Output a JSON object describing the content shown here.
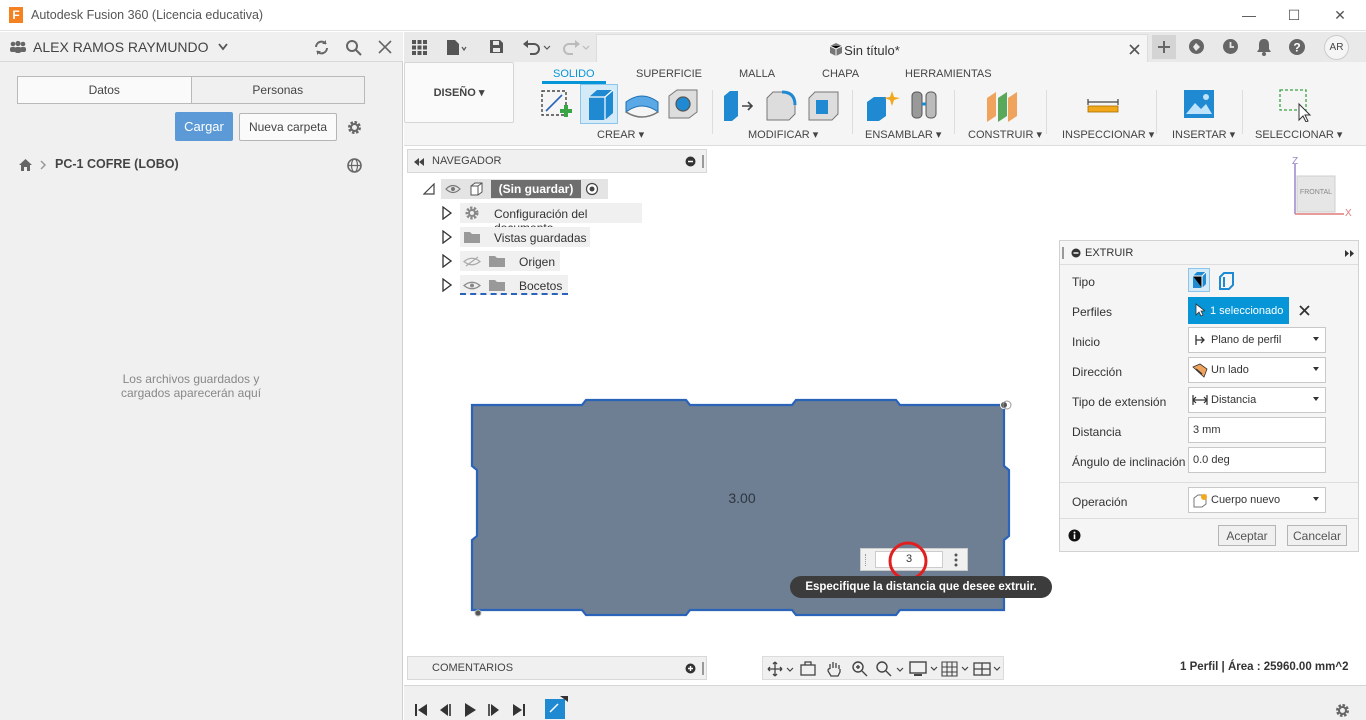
{
  "app": {
    "title": "Autodesk Fusion 360 (Licencia educativa)",
    "logo_letter": "F"
  },
  "left_panel": {
    "user": "ALEX RAMOS RAYMUNDO",
    "tabs": [
      "Datos",
      "Personas"
    ],
    "upload_button": "Cargar",
    "new_folder_button": "Nueva carpeta",
    "project": "PC-1 COFRE (LOBO)",
    "empty_message_line1": "Los archivos guardados y",
    "empty_message_line2": "cargados aparecerán aquí"
  },
  "document": {
    "tab_title": "Sin título*",
    "user_initials": "AR"
  },
  "ribbon": {
    "workspace": "DISEÑO",
    "tabs": [
      "SOLIDO",
      "SUPERFICIE",
      "MALLA",
      "CHAPA",
      "HERRAMIENTAS"
    ],
    "active_tab": "SOLIDO",
    "groups": [
      "CREAR",
      "MODIFICAR",
      "ENSAMBLAR",
      "CONSTRUIR",
      "INSPECCIONAR",
      "INSERTAR",
      "SELECCIONAR"
    ]
  },
  "browser": {
    "header": "NAVEGADOR",
    "root": "(Sin guardar)",
    "items": [
      "Configuración del documento",
      "Vistas guardadas",
      "Origen",
      "Bocetos"
    ]
  },
  "comments": {
    "header": "COMENTARIOS"
  },
  "viewcube": {
    "face": "FRONTAL",
    "axis_z": "Z",
    "axis_x": "X"
  },
  "sketch": {
    "dimension_label": "3.00"
  },
  "distance_input": {
    "value": "3"
  },
  "tooltip": "Especifique la distancia que desee extruir.",
  "extrude_dialog": {
    "title": "EXTRUIR",
    "fields": {
      "tipo": "Tipo",
      "perfiles": "Perfiles",
      "inicio": "Inicio",
      "direccion": "Dirección",
      "tipo_extension": "Tipo de extensión",
      "distancia": "Distancia",
      "angulo": "Ángulo de inclinación",
      "operacion": "Operación"
    },
    "values": {
      "perfiles": "1 seleccionado",
      "inicio": "Plano de perfil",
      "direccion": "Un lado",
      "tipo_extension": "Distancia",
      "distancia": "3 mm",
      "angulo": "0.0 deg",
      "operacion": "Cuerpo nuevo"
    },
    "ok": "Aceptar",
    "cancel": "Cancelar"
  },
  "status_bar": "1 Perfil | Área : 25960.00 mm^2",
  "colors": {
    "accent": "#0696d7",
    "profile_fill": "#6e7f94",
    "profile_edge": "#2a63b8",
    "upload": "#5b9ad6"
  }
}
